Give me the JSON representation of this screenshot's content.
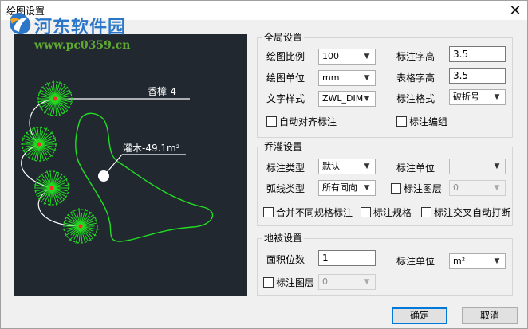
{
  "window": {
    "title": "绘图设置"
  },
  "watermark": {
    "site_name": "河东软件园",
    "url": "www.pc0359.cn"
  },
  "preview": {
    "label_tree": "香樟-4",
    "label_shrub": "灌木-49.1m²"
  },
  "global": {
    "title": "全局设置",
    "scale_label": "绘图比例",
    "scale_value": "100",
    "unit_label": "绘图单位",
    "unit_value": "mm",
    "font_style_label": "文字样式",
    "font_style_value": "ZWL_DIM",
    "annot_height_label": "标注字高",
    "annot_height_value": "3.5",
    "table_height_label": "表格字高",
    "table_height_value": "3.5",
    "annot_format_label": "标注格式",
    "annot_format_value": "破折号",
    "auto_align_label": "自动对齐标注",
    "annot_group_label": "标注编组"
  },
  "tree": {
    "title": "乔灌设置",
    "annot_type_label": "标注类型",
    "annot_type_value": "默认",
    "annot_unit_label": "标注单位",
    "annot_unit_value": "",
    "arc_type_label": "弧线类型",
    "arc_type_value": "所有同向",
    "annot_layer_label": "标注图层",
    "annot_layer_value": "0",
    "merge_label": "合并不同规格标注",
    "spec_label": "标注规格",
    "cross_break_label": "标注交叉自动打断"
  },
  "ground": {
    "title": "地被设置",
    "area_digits_label": "面积位数",
    "area_digits_value": "1",
    "annot_unit_label": "标注单位",
    "annot_unit_value": "m²",
    "annot_layer_label": "标注图层",
    "annot_layer_value": "0"
  },
  "buttons": {
    "ok": "确定",
    "cancel": "取消"
  },
  "colors": {
    "tree_green": "#22dd22",
    "accent_blue": "#0078d7",
    "canvas_bg": "#212830"
  }
}
